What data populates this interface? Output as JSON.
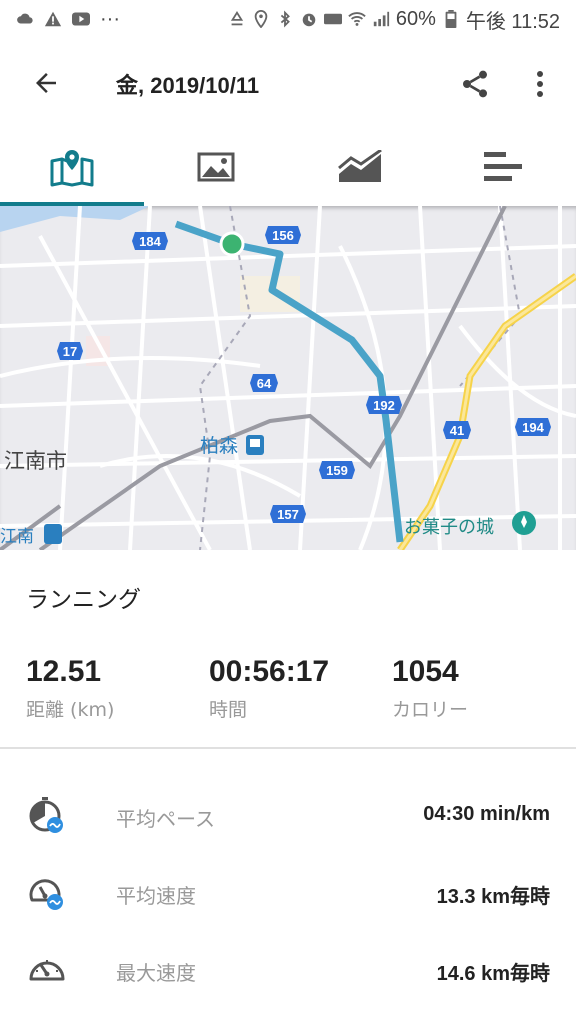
{
  "status_bar": {
    "battery_percent": "60%",
    "time": "午後 11:52",
    "more": "···"
  },
  "header": {
    "title": "金, 2019/10/11"
  },
  "tabs": [
    {
      "name": "map",
      "icon": "map-icon",
      "active": true
    },
    {
      "name": "photos",
      "icon": "image-icon",
      "active": false
    },
    {
      "name": "charts",
      "icon": "area-chart-icon",
      "active": false
    },
    {
      "name": "splits",
      "icon": "bar-list-icon",
      "active": false
    }
  ],
  "map": {
    "route_color": "#4aa3c8",
    "road_labels": [
      "184",
      "156",
      "17",
      "64",
      "192",
      "41",
      "194",
      "159",
      "157"
    ],
    "place_labels": {
      "city": "江南市",
      "station": "柏森",
      "station_edge": "江南",
      "poi": "お菓子の城"
    }
  },
  "activity": {
    "type": "ランニング",
    "distance": {
      "value": "12.51",
      "label": "距離 (km)"
    },
    "duration": {
      "value": "00:56:17",
      "label": "時間"
    },
    "calories": {
      "value": "1054",
      "label": "カロリー"
    }
  },
  "metrics": [
    {
      "label": "平均ペース",
      "value": "04:30 min/km",
      "icon": "pace-icon"
    },
    {
      "label": "平均速度",
      "value": "13.3 km毎時",
      "icon": "speedometer-avg-icon"
    },
    {
      "label": "最大速度",
      "value": "14.6 km毎時",
      "icon": "speedometer-icon"
    }
  ],
  "colors": {
    "accent": "#127c8c",
    "route": "#4aa3c8",
    "start_marker": "#3cb371",
    "highway_badge": "#2f6fd6"
  }
}
